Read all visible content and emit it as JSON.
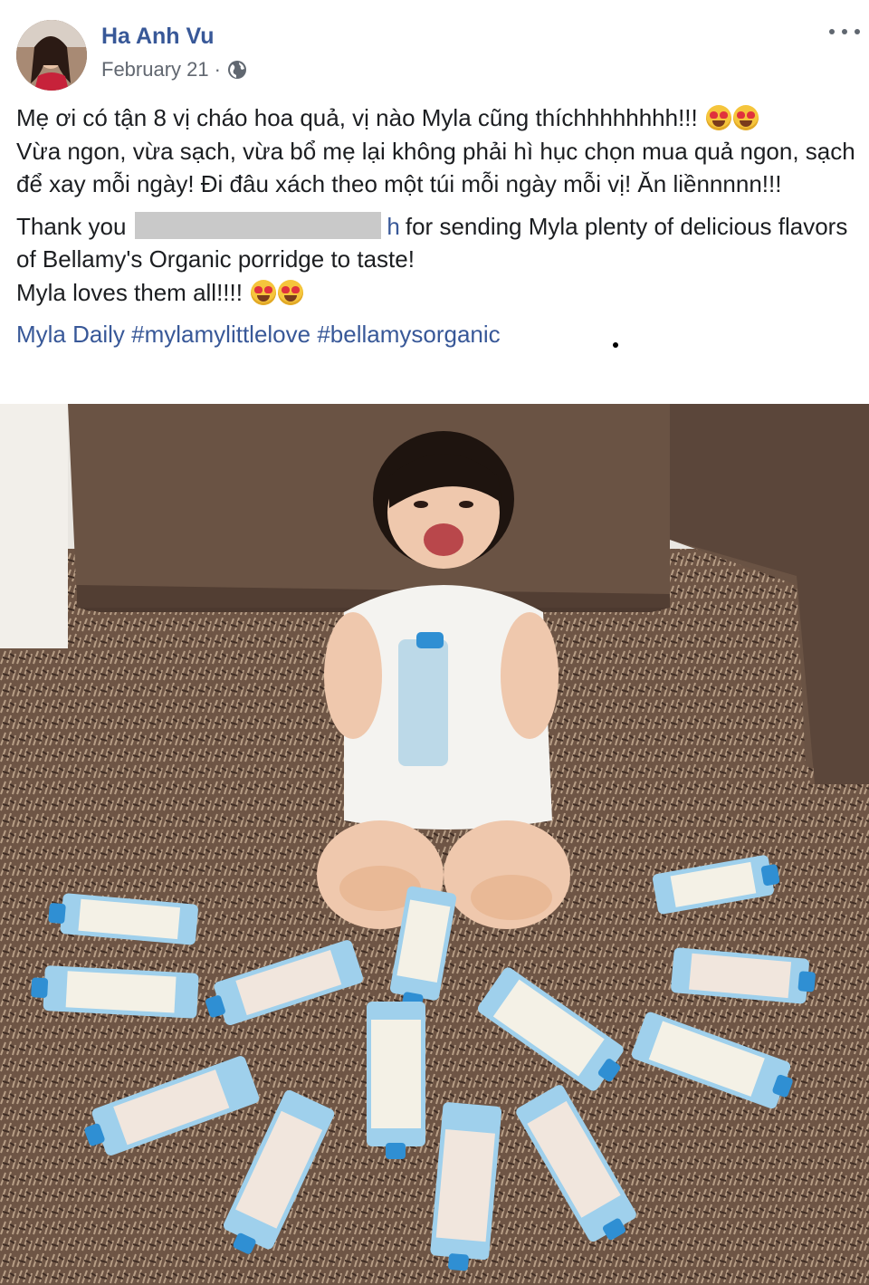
{
  "post": {
    "author": "Ha Anh Vu",
    "date": "February 21",
    "separator": "·",
    "privacy_icon": "globe-icon",
    "menu_icon": "more-options-icon"
  },
  "text": {
    "p1_a": "Mẹ ơi có tận 8 vị cháo hoa quả, vị nào Myla cũng thíchhhhhhhh!!!",
    "p1_b": "Vừa ngon, vừa sạch, vừa bổ mẹ lại không phải hì hục chọn mua quả ngon, sạch để xay mỗi ngày! Đi đâu xách theo một túi mỗi ngày mỗi vị! Ăn liềnnnnn!!!",
    "p2_a": "Thank you",
    "p2_tail": "h",
    "p2_b": "for sending Myla plenty of delicious flavors of Bellamy's Organic porridge to taste!",
    "p2_c": "Myla loves them all!!!!",
    "tags": [
      "Myla Daily",
      "#mylamylittlelove",
      "#bellamysorganic"
    ]
  },
  "colors": {
    "link": "#385898",
    "secondary": "#616770"
  },
  "emoji": "heart-eyes-emoji"
}
